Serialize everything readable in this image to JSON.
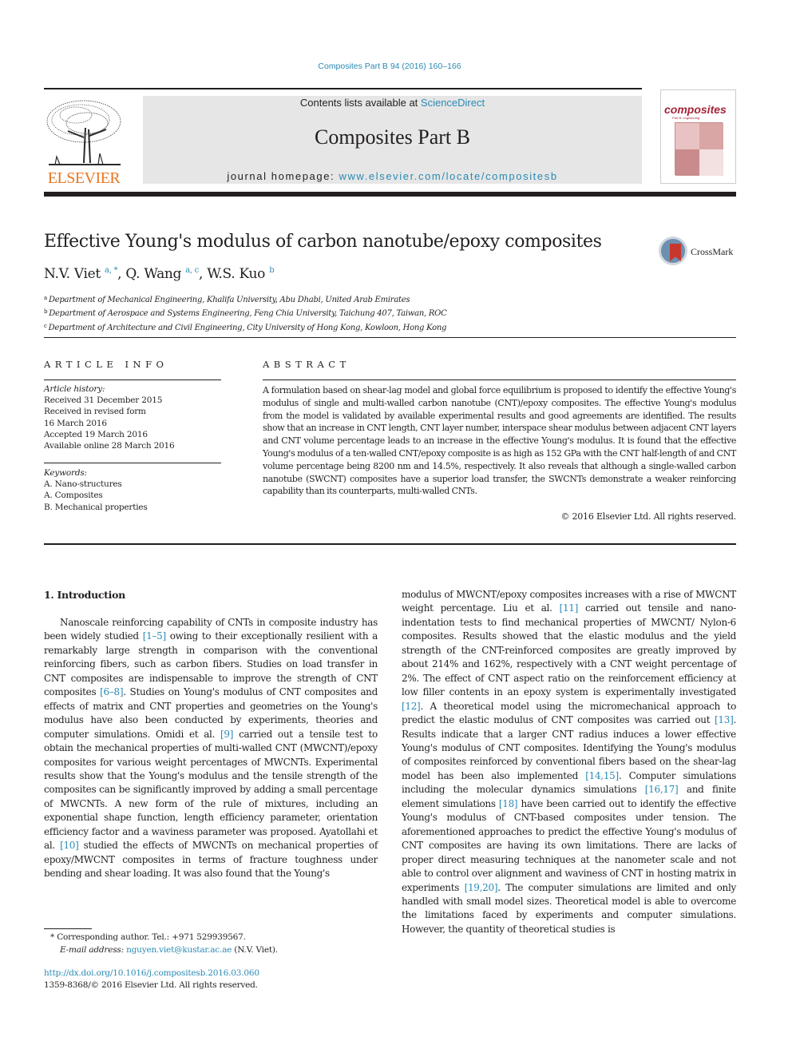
{
  "header": {
    "citation": "Composites Part B 94 (2016) 160–166",
    "contents_prefix": "Contents lists available at ",
    "contents_link": "ScienceDirect",
    "journal_name": "Composites Part B",
    "homepage_prefix": "journal homepage: ",
    "homepage_link": "www.elsevier.com/locate/compositesb",
    "publisher_logo_text": "ELSEVIER",
    "cover_title": "composites",
    "cover_subtitle": "Part B: engineering",
    "crossmark_label": "CrossMark",
    "colors": {
      "link": "#2a8ab4",
      "elsevier_orange": "#e87722",
      "cover_red": "#a3243b",
      "banner_gray": "#e6e6e6"
    }
  },
  "article": {
    "title": "Effective Young's modulus of carbon nanotube/epoxy composites",
    "authors": [
      {
        "name": "N.V. Viet",
        "sup": "a, *"
      },
      {
        "name": "Q. Wang",
        "sup": "a, c"
      },
      {
        "name": "W.S. Kuo",
        "sup": "b"
      }
    ],
    "affiliations": [
      {
        "mark": "a",
        "text": "Department of Mechanical Engineering, Khalifa University, Abu Dhabi, United Arab Emirates"
      },
      {
        "mark": "b",
        "text": "Department of Aerospace and Systems Engineering, Feng Chia University, Taichung 407, Taiwan, ROC"
      },
      {
        "mark": "c",
        "text": "Department of Architecture and Civil Engineering, City University of Hong Kong, Kowloon, Hong Kong"
      }
    ]
  },
  "article_info": {
    "heading": "ARTICLE INFO",
    "history_label": "Article history:",
    "history": [
      "Received 31 December 2015",
      "Received in revised form",
      "16 March 2016",
      "Accepted 19 March 2016",
      "Available online 28 March 2016"
    ],
    "keywords_label": "Keywords:",
    "keywords": [
      "A. Nano-structures",
      "A. Composites",
      "B. Mechanical properties"
    ]
  },
  "abstract": {
    "heading": "ABSTRACT",
    "text": "A formulation based on shear-lag model and global force equilibrium is proposed to identify the effective Young's modulus of single and multi-walled carbon nanotube (CNT)/epoxy composites. The effective Young's modulus from the model is validated by available experimental results and good agreements are identified. The results show that an increase in CNT length, CNT layer number, interspace shear modulus between adjacent CNT layers and CNT volume percentage leads to an increase in the effective Young's modulus. It is found that the effective Young's modulus of a ten-walled CNT/epoxy composite is as high as 152 GPa with the CNT half-length of and CNT volume percentage being 8200 nm and 14.5%, respectively. It also reveals that although a single-walled carbon nanotube (SWCNT) composites have a superior load transfer, the SWCNTs demonstrate a weaker reinforcing capability than its counterparts, multi-walled CNTs.",
    "copyright": "© 2016 Elsevier Ltd. All rights reserved."
  },
  "introduction": {
    "heading": "1.  Introduction",
    "left_segments": [
      {
        "t": "Nanoscale reinforcing capability of CNTs in composite industry has been widely studied "
      },
      {
        "ref": "[1–5]"
      },
      {
        "t": " owing to their exceptionally resilient with a remarkably large strength in comparison with the conventional reinforcing fibers, such as carbon fibers. Studies on load transfer in CNT composites are indispensable to improve the strength of CNT composites "
      },
      {
        "ref": "[6–8]"
      },
      {
        "t": ". Studies on Young's modulus of CNT composites and effects of matrix and CNT properties and geometries on the Young's modulus have also been conducted by experiments, theories and computer simulations. Omidi et al. "
      },
      {
        "ref": "[9]"
      },
      {
        "t": " carried out a tensile test to obtain the mechanical properties of multi-walled CNT (MWCNT)/epoxy composites for various weight percentages of MWCNTs. Experimental results show that the Young's modulus and the tensile strength of the composites can be significantly improved by adding a small percentage of MWCNTs. A new form of the rule of mixtures, including an exponential shape function, length efficiency parameter, orientation efficiency factor and a waviness parameter was proposed. Ayatollahi et al. "
      },
      {
        "ref": "[10]"
      },
      {
        "t": " studied the effects of MWCNTs on mechanical properties of epoxy/MWCNT composites in terms of fracture toughness under bending and shear loading. It was also found that the Young's"
      }
    ],
    "right_segments": [
      {
        "t": "modulus of MWCNT/epoxy composites increases with a rise of MWCNT weight percentage. Liu et al. "
      },
      {
        "ref": "[11]"
      },
      {
        "t": " carried out tensile and nano-indentation tests to find mechanical properties of MWCNT/ Nylon-6 composites. Results showed that the elastic modulus and the yield strength of the CNT-reinforced composites are greatly improved by about 214% and 162%, respectively with a CNT weight percentage of 2%. The effect of CNT aspect ratio on the reinforcement efficiency at low filler contents in an epoxy system is experimentally investigated "
      },
      {
        "ref": "[12]"
      },
      {
        "t": ". A theoretical model using the micromechanical approach to predict the elastic modulus of CNT composites was carried out "
      },
      {
        "ref": "[13]"
      },
      {
        "t": ". Results indicate that a larger CNT radius induces a lower effective Young's modulus of CNT composites. Identifying the Young's modulus of composites reinforced by conventional fibers based on the shear-lag model has been also implemented "
      },
      {
        "ref": "[14,15]"
      },
      {
        "t": ". Computer simulations including the molecular dynamics simulations "
      },
      {
        "ref": "[16,17]"
      },
      {
        "t": " and finite element simulations "
      },
      {
        "ref": "[18]"
      },
      {
        "t": " have been carried out to identify the effective Young's modulus of CNT-based composites under tension. The aforementioned approaches to predict the effective Young's modulus of CNT composites are having its own limitations. There are lacks of proper direct measuring techniques at the nanometer scale and not able to control over alignment and waviness of CNT in hosting matrix in experiments "
      },
      {
        "ref": "[19,20]"
      },
      {
        "t": ". The computer simulations are limited and only handled with small model sizes. Theoretical model is able to overcome the limitations faced by experiments and computer simulations. However, the quantity of theoretical studies is"
      }
    ]
  },
  "footnote": {
    "corresponding": "* Corresponding author. Tel.: +971 529939567.",
    "email_label": "E-mail address: ",
    "email": "nguyen.viet@kustar.ac.ae",
    "email_suffix": " (N.V. Viet).",
    "doi": "http://dx.doi.org/10.1016/j.compositesb.2016.03.060",
    "issn": "1359-8368/© 2016 Elsevier Ltd. All rights reserved."
  }
}
